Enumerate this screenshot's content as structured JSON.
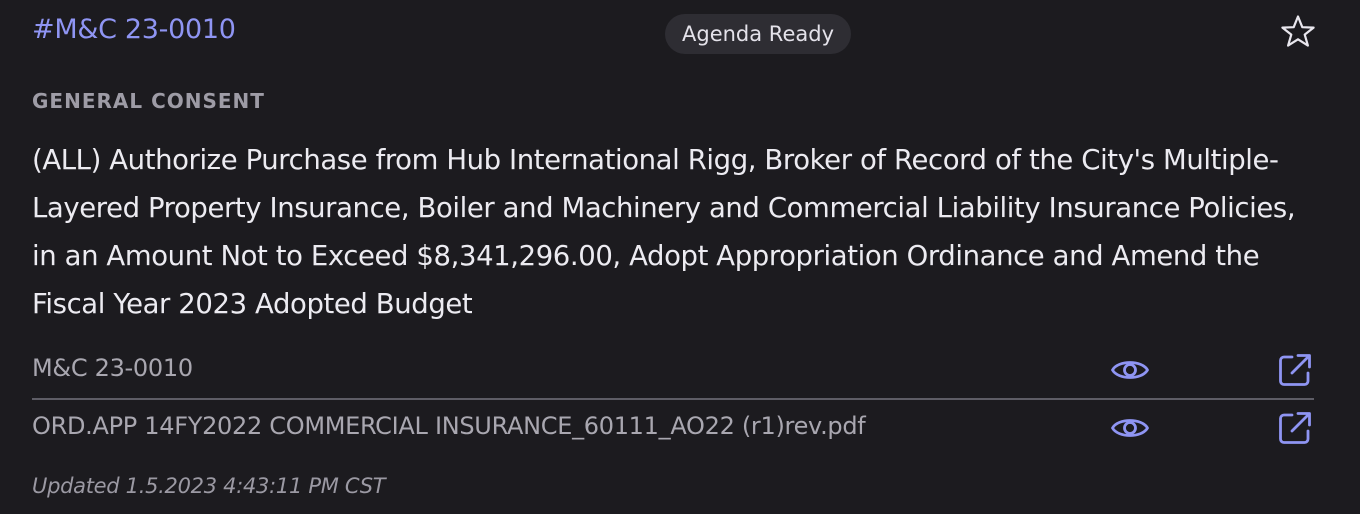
{
  "header": {
    "item_id": "#M&C 23-0010",
    "status": "Agenda Ready",
    "favorite_icon": "star-outline-icon"
  },
  "section_label": "GENERAL CONSENT",
  "title": "(ALL) Authorize Purchase from Hub International Rigg, Broker of Record of the City's Multiple-Layered Property Insurance, Boiler and Machinery and Commercial Liability Insurance Policies, in an Amount Not to Exceed $8,341,296.00, Adopt Appropriation Ordinance and Amend the Fiscal Year 2023 Adopted Budget",
  "attachments": [
    {
      "name": "M&C 23-0010",
      "view_icon": "eye-icon",
      "open_icon": "external-link-icon"
    },
    {
      "name": "ORD.APP 14FY2022 COMMERCIAL INSURANCE_60111_AO22 (r1)rev.pdf",
      "view_icon": "eye-icon",
      "open_icon": "external-link-icon"
    }
  ],
  "updated": "Updated 1.5.2023 4:43:11 PM CST",
  "colors": {
    "background": "#1c1b1f",
    "accent": "#8f95f3",
    "badge_bg": "#2e2d33",
    "divider": "#5e5d66"
  }
}
